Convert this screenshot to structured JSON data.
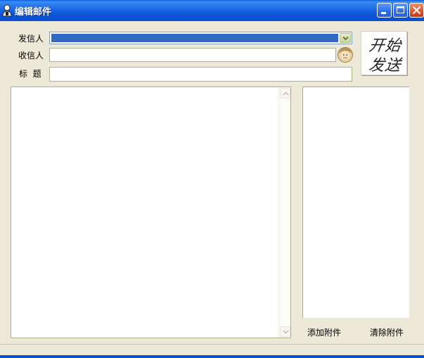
{
  "window": {
    "title": "编辑邮件"
  },
  "form": {
    "from_label": "发信人",
    "to_label": "收信人",
    "subject_label": "标  题",
    "from_value": "",
    "to_value": "",
    "subject_value": "",
    "body_value": ""
  },
  "send_button": {
    "line1": "开始",
    "line2": "发送"
  },
  "attachments": {
    "add_label": "添加附件",
    "clear_label": "清除附件",
    "items": []
  },
  "icons": {
    "app": "user-icon",
    "contacts": "contact-face-icon",
    "minimize": "minimize-icon",
    "maximize": "maximize-icon",
    "close": "close-icon",
    "dropdown": "chevron-down-icon",
    "scroll_up": "scroll-up-icon",
    "scroll_down": "scroll-down-icon"
  },
  "colors": {
    "titlebar": "#0a55d6",
    "selection": "#316ac5",
    "window_bg": "#ece9d8",
    "close_button": "#e2552e"
  }
}
